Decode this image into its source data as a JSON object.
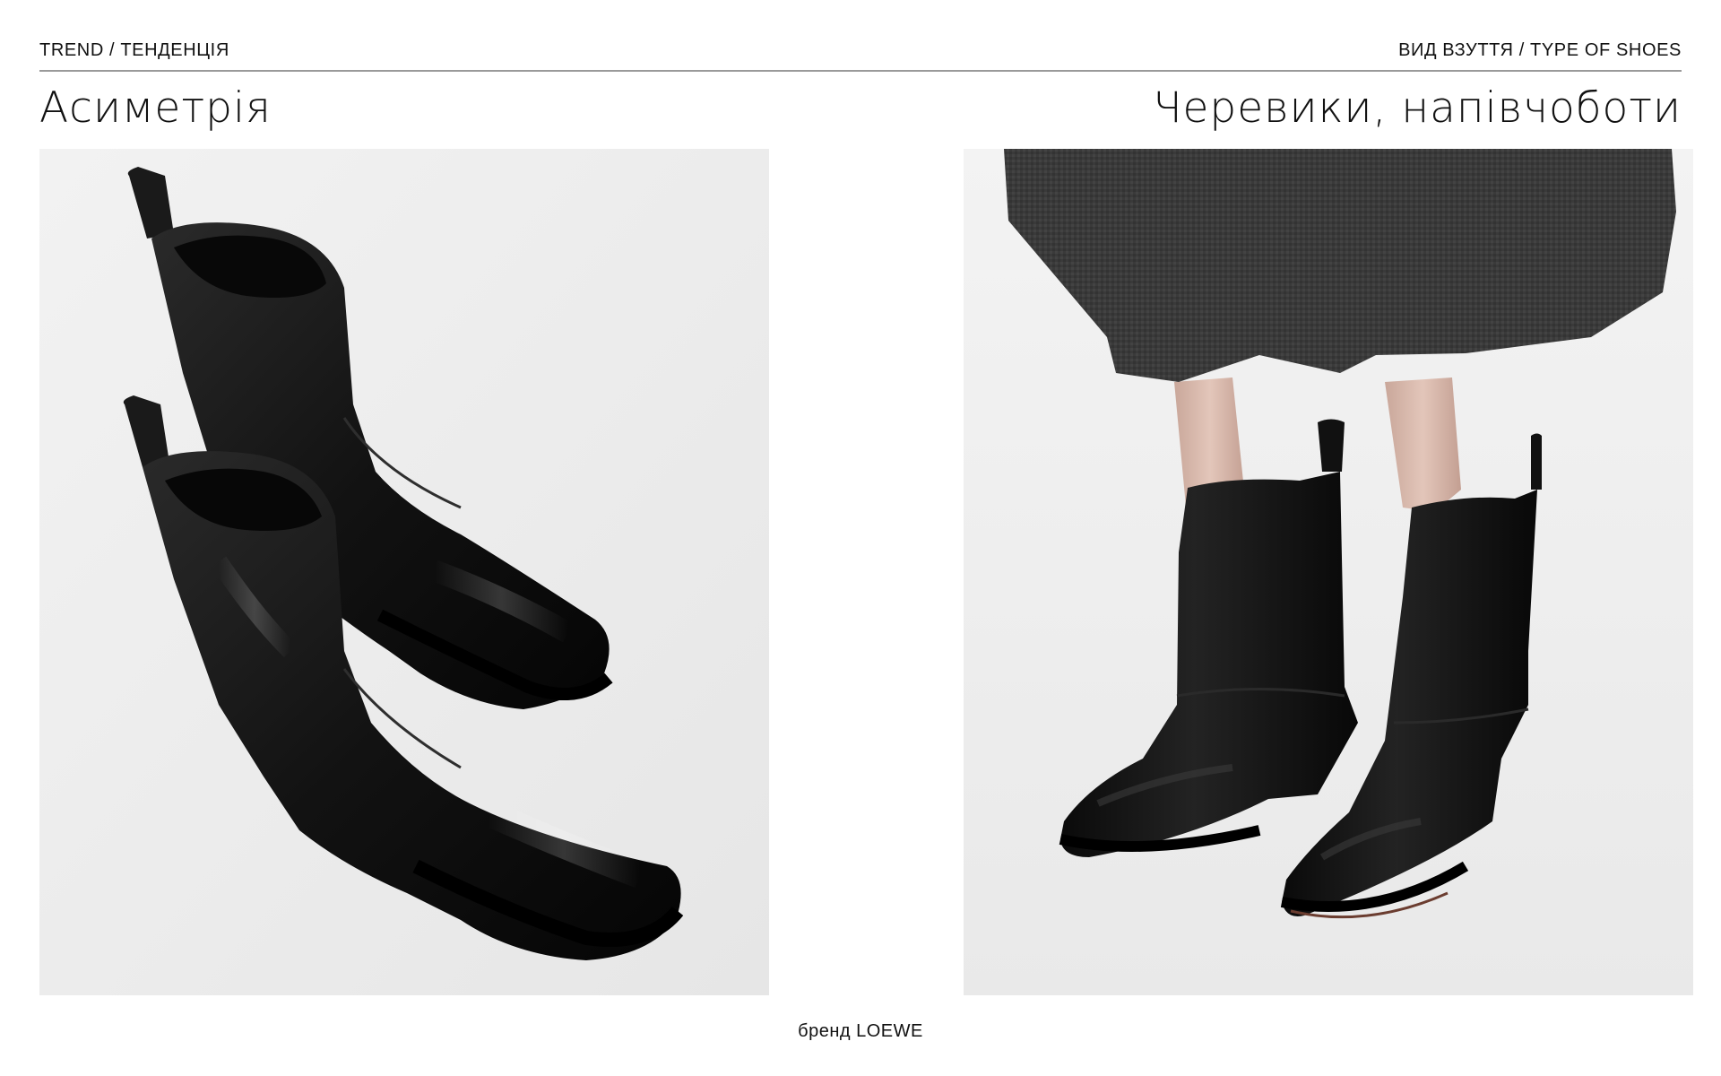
{
  "header": {
    "trend_label": "TREND / ТЕНДЕНЦІЯ",
    "type_label": "ВИД ВЗУТТЯ / TYPE OF SHOES"
  },
  "titles": {
    "trend_title": "Асиметрія",
    "type_title": "Черевики, напівчоботи"
  },
  "photos": {
    "product_photo": "boots-product-photo",
    "model_photo": "boots-on-model-photo"
  },
  "footer": {
    "brand_caption": "бренд LOEWE"
  },
  "colors": {
    "background": "#ffffff",
    "rule": "#9a9a9a",
    "photo_bg": "#ededed",
    "leather": "#151515",
    "skirt": "#3a3a3a"
  }
}
